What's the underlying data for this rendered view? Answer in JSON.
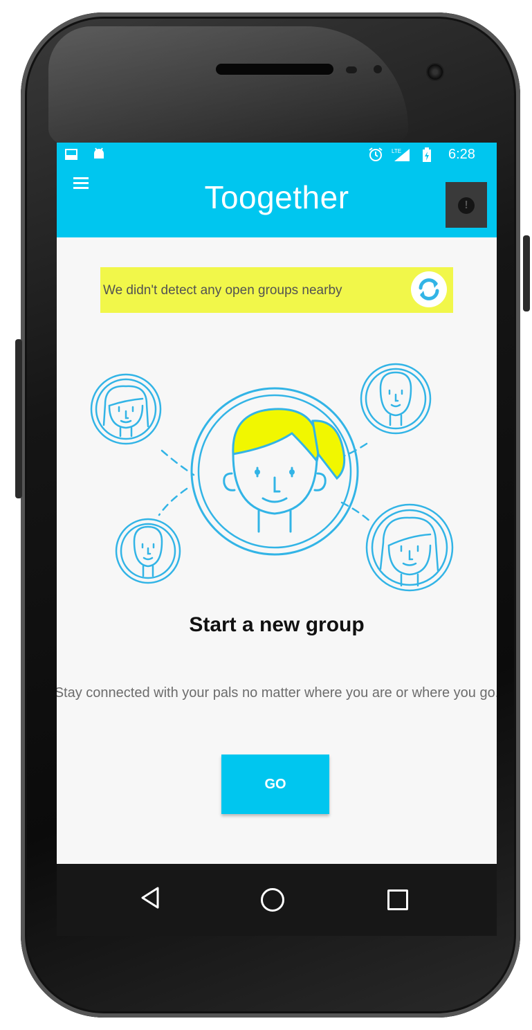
{
  "status_bar": {
    "time": "6:28",
    "icons": [
      "image-notification-icon",
      "android-notification-icon",
      "alarm-icon",
      "lte-signal-icon",
      "battery-icon"
    ]
  },
  "app_bar": {
    "title": "Toogether",
    "menu_icon": "hamburger-menu-icon",
    "alert_icon": "alert-icon",
    "alert_symbol": "!"
  },
  "banner": {
    "message": "We didn't detect any open groups nearby",
    "refresh_icon": "refresh-icon"
  },
  "main": {
    "illustration": "group-people-illustration",
    "headline": "Start a new group",
    "description": "Stay connected with your pals no matter where you are or where you go.",
    "go_button": "GO"
  },
  "nav_bar": {
    "back_icon": "back-icon",
    "home_icon": "home-icon",
    "recents_icon": "recents-icon"
  },
  "colors": {
    "accent": "#00c6ef",
    "banner": "#f1f74a",
    "background": "#f7f7f7",
    "line_art": "#32b4e6",
    "hair": "#f1f700"
  }
}
